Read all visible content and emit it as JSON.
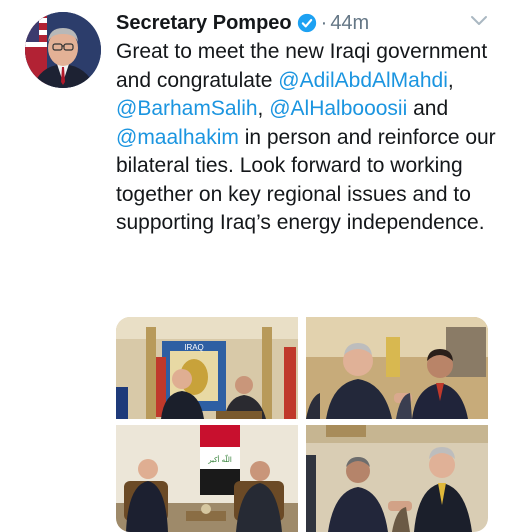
{
  "tweet": {
    "author_name": "Secretary Pompeo",
    "separator": "·",
    "time": "44m",
    "text": {
      "part1": "Great to meet the new Iraqi government and congratulate ",
      "mention1": "@AdilAbdAlMahdi",
      "part2": ", ",
      "mention2": "@BarhamSalih",
      "part3": ", ",
      "mention3": "@AlHalbooosii",
      "part4": " and ",
      "mention4": "@maalhakim",
      "part5": " in person and reinforce our bilateral ties. Look forward to working together on key regional issues and to supporting Iraq’s energy independence."
    }
  },
  "icons": {
    "verified": "verified-badge-icon",
    "chevron": "chevron-down-icon"
  },
  "colors": {
    "mention": "#1b95e0",
    "verified": "#1da1f2",
    "meta": "#657786"
  },
  "photos": {
    "photo1_sign": "IRAQ"
  }
}
